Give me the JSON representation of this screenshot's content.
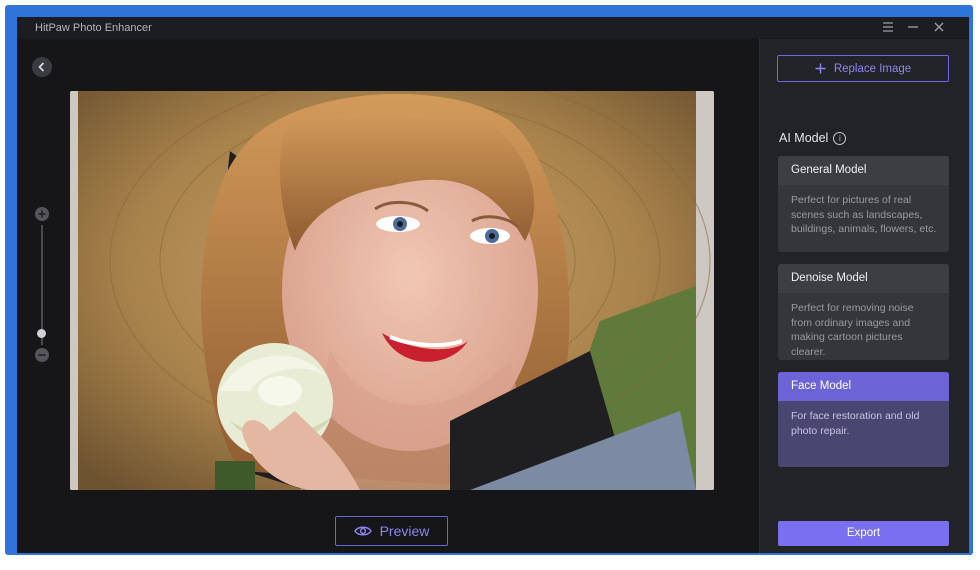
{
  "app": {
    "title": "HitPaw Photo Enhancer"
  },
  "window_controls": {
    "menu_icon": "menu-icon",
    "minimize_icon": "minimize-icon",
    "close_icon": "close-icon"
  },
  "canvas": {
    "back_icon": "chevron-left-icon",
    "zoom": {
      "plus_icon": "plus-icon",
      "minus_icon": "minus-icon",
      "level": 0.13
    },
    "preview_label": "Preview",
    "preview_icon": "eye-icon"
  },
  "sidebar": {
    "replace_label": "Replace Image",
    "replace_icon": "plus-icon",
    "ai_model_heading": "AI Model",
    "models": [
      {
        "name": "General Model",
        "desc": "Perfect for pictures of real scenes such as landscapes, buildings, animals, flowers, etc.",
        "selected": false
      },
      {
        "name": "Denoise Model",
        "desc": "Perfect for removing noise from ordinary images and making cartoon pictures clearer.",
        "selected": false
      },
      {
        "name": "Face Model",
        "desc": "For face restoration and old photo repair.",
        "selected": true
      }
    ],
    "export_label": "Export"
  },
  "colors": {
    "accent": "#7a6ff0",
    "frame": "#2f74d9",
    "background": "#161618",
    "panel": "#222326"
  }
}
